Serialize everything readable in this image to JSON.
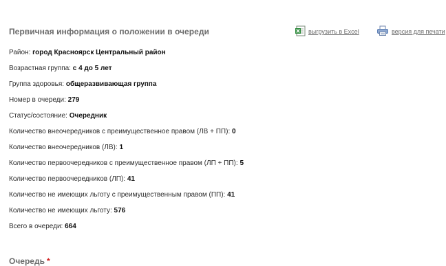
{
  "header": {
    "title": "Первичная информация о положении в очереди"
  },
  "actions": {
    "excel_label": "выгрузить в Excel",
    "excel_icon": "excel-icon",
    "print_label": "версия для печати",
    "print_icon": "printer-icon"
  },
  "info": [
    {
      "label": "Район:",
      "value": "город Красноярск Центральный район"
    },
    {
      "label": "Возрастная группа:",
      "value": "с 4 до 5 лет"
    },
    {
      "label": "Группа здоровья:",
      "value": "общеразвивающая группа"
    },
    {
      "label": "Номер в очереди:",
      "value": "279"
    },
    {
      "label": "Статус/состояние:",
      "value": "Очередник"
    },
    {
      "label": "Количество внеочередников с преимущественное правом (ЛВ + ПП):",
      "value": "0"
    },
    {
      "label": "Количество внеочередников (ЛВ):",
      "value": "1"
    },
    {
      "label": "Количество первоочередников с преимущественное правом (ЛП + ПП):",
      "value": "5"
    },
    {
      "label": "Количество первоочередников (ЛП):",
      "value": "41"
    },
    {
      "label": "Количество не имеющих льготу с преимущественным правом (ПП):",
      "value": "41"
    },
    {
      "label": "Количество не имеющих льготу:",
      "value": "576"
    },
    {
      "label": "Всего в очереди:",
      "value": "664"
    }
  ],
  "queue": {
    "title": "Очередь",
    "required_mark": "*"
  },
  "colors": {
    "title_gray": "#6b6b6b",
    "required_red": "#d11f1f",
    "excel_green": "#2e8b3c",
    "printer_blue": "#5b7fb5"
  }
}
